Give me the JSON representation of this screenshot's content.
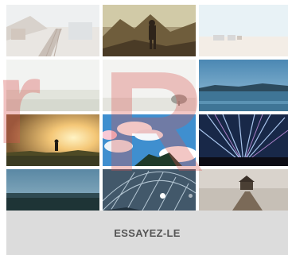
{
  "watermark": {
    "text": "r R"
  },
  "gallery": {
    "tiles": [
      {
        "label": "seaside-town-railway"
      },
      {
        "label": "hiker-in-mountains"
      },
      {
        "label": "beach-with-chairs"
      },
      {
        "label": "misty-field"
      },
      {
        "label": "tree-in-fog"
      },
      {
        "label": "lake-at-sunset-blue"
      },
      {
        "label": "sunset-runner"
      },
      {
        "label": "clouds-blue-sky"
      },
      {
        "label": "concert-light-show"
      },
      {
        "label": "dusk-horizon-sea"
      },
      {
        "label": "glass-dome-structure"
      },
      {
        "label": "pier-gazebo-sea"
      }
    ],
    "carousel_dots": 2
  },
  "footer": {
    "cta_label": "ESSAYEZ-LE"
  },
  "colors": {
    "footer_bg": "#dcdcdc",
    "cta_text": "#555555",
    "watermark": "#d9534f"
  }
}
